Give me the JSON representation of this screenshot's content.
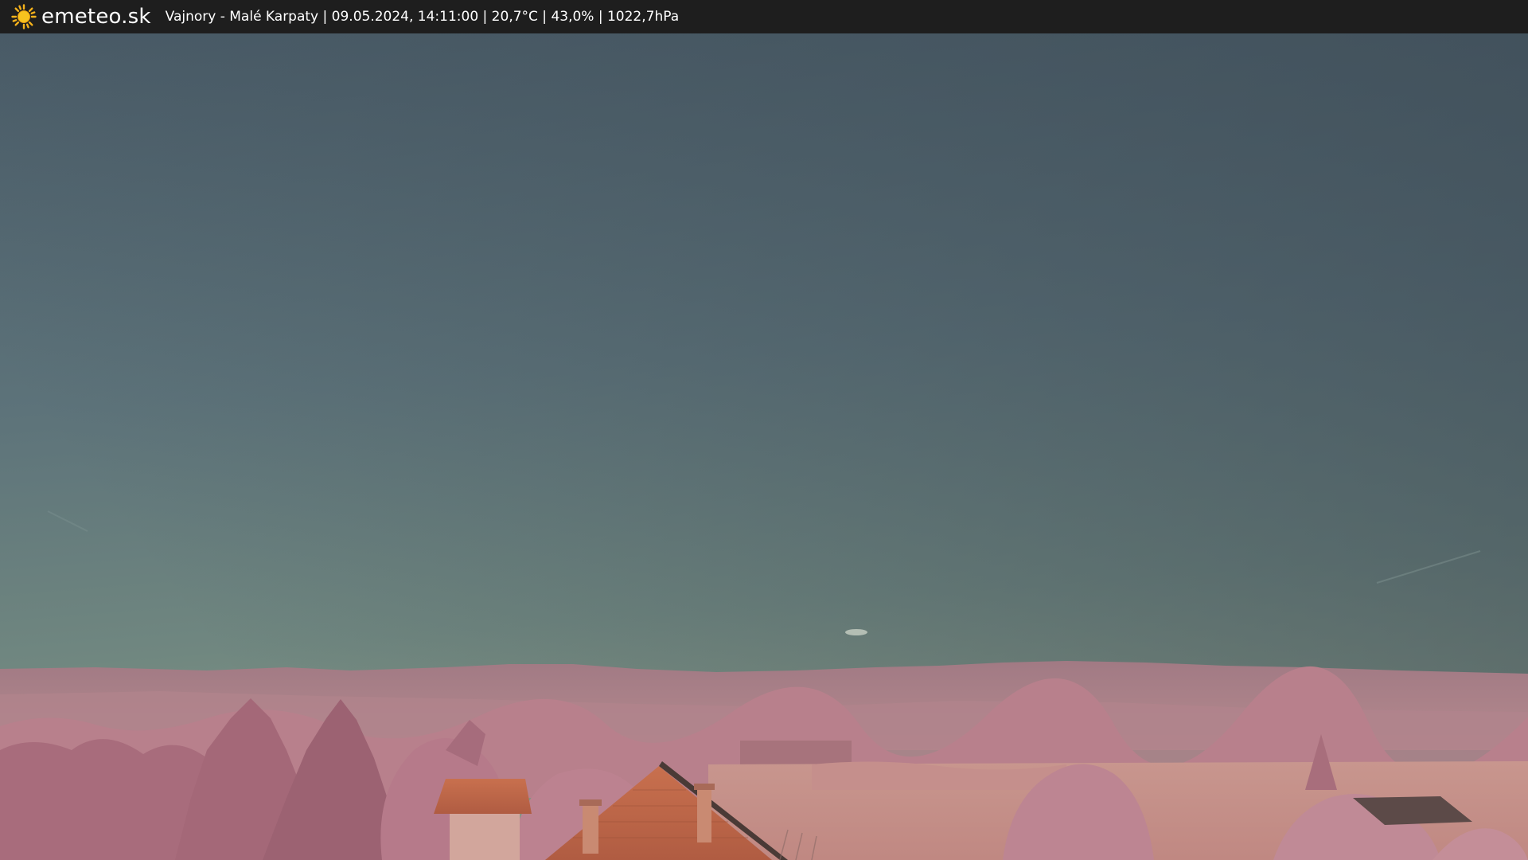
{
  "header": {
    "brand": "emeteo.sk",
    "logo_icon": "sun-icon",
    "station_info": "Vajnory - Malé Karpaty | 09.05.2024, 14:11:00 | 20,7°C | 43,0% | 1022,7hPa"
  },
  "colors": {
    "topbar": "#1e1e1e",
    "sky_top": "#465864",
    "sky_bottom": "#8a9a86",
    "hills": "#a27a82",
    "foliage": "#b97e8c",
    "roof": "#c46a4c",
    "field": "#c79088",
    "sun": "#f5b21b"
  }
}
